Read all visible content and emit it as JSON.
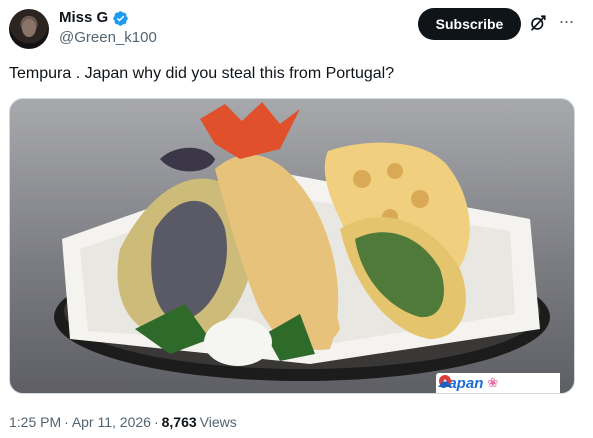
{
  "author": {
    "name": "Miss G",
    "handle": "@Green_k100",
    "verified_color": "#1d9bf0"
  },
  "actions": {
    "subscribe_label": "Subscribe",
    "grok_icon": "grok-icon",
    "more_icon": "more-icon"
  },
  "tweet": {
    "text": "Tempura . Japan why did you steal this from Portugal?"
  },
  "media": {
    "alt": "Tempura",
    "watermark_text": "Japan",
    "watermark_flower": "❀"
  },
  "meta": {
    "time": "1:25 PM",
    "sep1": "·",
    "date": "Apr 11, 2026",
    "sep2": "·",
    "views_count": "8,763",
    "views_label": "Views"
  }
}
